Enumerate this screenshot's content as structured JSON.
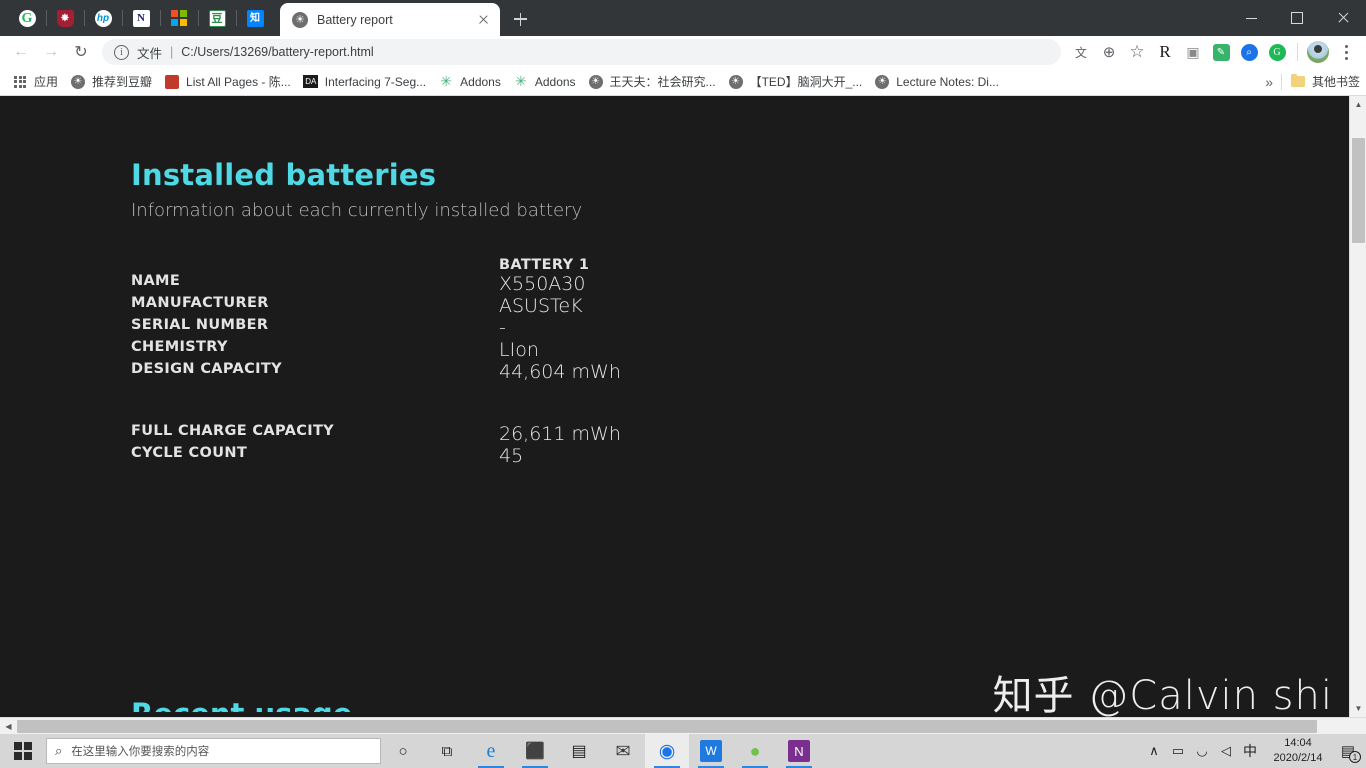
{
  "window": {
    "minimize_label": "Minimize",
    "restore_label": "Restore",
    "close_label": "Close"
  },
  "tabstrip": {
    "pinned_tabs": [
      {
        "name": "grammarly-pinned-tab",
        "glyph": "G"
      },
      {
        "name": "shield-pinned-tab",
        "glyph": "✸"
      },
      {
        "name": "hp-pinned-tab",
        "glyph": "hp"
      },
      {
        "name": "notion-pinned-tab",
        "glyph": "✉"
      },
      {
        "name": "microsoft-pinned-tab",
        "glyph": ""
      },
      {
        "name": "douban-pinned-tab",
        "glyph": "豆"
      },
      {
        "name": "zhihu-pinned-tab",
        "glyph": "知"
      }
    ],
    "active_tab": {
      "title": "Battery report",
      "favicon": "globe-icon"
    },
    "new_tab_label": "+"
  },
  "toolbar": {
    "back_label": "←",
    "forward_label": "→",
    "reload_label": "↻",
    "omnibox": {
      "info_glyph": "i",
      "scheme_label": "文件",
      "separator": "|",
      "url": "C:/Users/13269/battery-report.html"
    },
    "right_icons": [
      {
        "name": "translate-icon",
        "glyph": "文",
        "color": "#5f6368"
      },
      {
        "name": "zoom-icon",
        "glyph": "⊕",
        "color": "#5f6368"
      },
      {
        "name": "bookmark-star-icon",
        "glyph": "☆",
        "color": "#5f6368"
      },
      {
        "name": "researchgate-extension-icon",
        "glyph": "R",
        "color": "#1b1b1b"
      },
      {
        "name": "screenshot-camera-extension-icon",
        "glyph": "▣",
        "color": "#8a8a8a"
      },
      {
        "name": "evernote-extension-icon",
        "glyph": "✎",
        "color": "#2dbe60"
      },
      {
        "name": "search-extension-icon",
        "glyph": "⌕",
        "color": "#ffffff"
      },
      {
        "name": "grammarly-extension-icon",
        "glyph": "G",
        "color": "#ffffff"
      }
    ],
    "profile_label": "Profile",
    "menu_label": "Customize and control Google Chrome"
  },
  "bookmarks": {
    "items": [
      {
        "icon": "apps-grid-icon",
        "label": "应用"
      },
      {
        "icon": "globe-icon",
        "label": "推荐到豆瓣"
      },
      {
        "icon": "douban-icon",
        "label": "List All Pages - 陈..."
      },
      {
        "icon": "dark-square-icon",
        "label": "Interfacing 7-Seg..."
      },
      {
        "icon": "puzzle-icon",
        "label": "Addons"
      },
      {
        "icon": "puzzle-icon",
        "label": "Addons"
      },
      {
        "icon": "globe-icon",
        "label": "王天夫：社会研究..."
      },
      {
        "icon": "globe-icon",
        "label": "【TED】脑洞大开_..."
      },
      {
        "icon": "globe-icon",
        "label": "Lecture Notes: Di..."
      }
    ],
    "overflow_label": "»",
    "other_bookmarks_label": "其他书签"
  },
  "page": {
    "heading": "Installed batteries",
    "subheading": "Information about each currently installed battery",
    "column_header": "BATTERY 1",
    "rows": [
      {
        "label": "NAME",
        "value": "X550A30"
      },
      {
        "label": "MANUFACTURER",
        "value": "ASUSTeK"
      },
      {
        "label": "SERIAL NUMBER",
        "value": "-"
      },
      {
        "label": "CHEMISTRY",
        "value": "LIon"
      },
      {
        "label": "DESIGN CAPACITY",
        "value": "44,604 mWh"
      },
      {
        "label": "FULL CHARGE CAPACITY",
        "value": "26,611 mWh"
      },
      {
        "label": "CYCLE COUNT",
        "value": "45"
      }
    ],
    "next_heading_partial": "Recent usage",
    "watermark": "知乎 @Calvin shi",
    "accent_color": "#4fd9e4",
    "background_color": "#1b1b1b"
  },
  "scrollbars": {
    "vertical_up": "▲",
    "vertical_down": "▼",
    "horizontal_left": "◀",
    "horizontal_right": "▶"
  },
  "taskbar": {
    "start_label": "Start",
    "search_placeholder": "在这里输入你要搜索的内容",
    "search_icon_glyph": "⌕",
    "cortana_label": "○",
    "items": [
      {
        "name": "taskview-button",
        "glyph": "⧉",
        "color": "#1f1f1f",
        "bg": "transparent",
        "state": "idle"
      },
      {
        "name": "edge-taskbar-icon",
        "glyph": "e",
        "color": "#1b7fd4",
        "bg": "transparent",
        "state": "running"
      },
      {
        "name": "file-explorer-taskbar-icon",
        "glyph": "⬛",
        "color": "#f2c14e",
        "bg": "transparent",
        "state": "running"
      },
      {
        "name": "microsoft-store-taskbar-icon",
        "glyph": "▤",
        "color": "#1f1f1f",
        "bg": "transparent",
        "state": "idle"
      },
      {
        "name": "mail-taskbar-icon",
        "glyph": "✉",
        "color": "#3c3c3c",
        "bg": "transparent",
        "state": "idle"
      },
      {
        "name": "chrome-taskbar-icon",
        "glyph": "◉",
        "color": "#1a73e8",
        "bg": "transparent",
        "state": "active"
      },
      {
        "name": "wps-taskbar-icon",
        "glyph": "W",
        "color": "#ffffff",
        "bg": "#1f7ae0",
        "state": "running"
      },
      {
        "name": "wechat-taskbar-icon",
        "glyph": "●",
        "color": "#6fc24a",
        "bg": "transparent",
        "state": "running"
      },
      {
        "name": "onenote-taskbar-icon",
        "glyph": "N",
        "color": "#ffffff",
        "bg": "#7a2f8f",
        "state": "running"
      }
    ],
    "tray": [
      {
        "name": "show-hidden-icons-chevron",
        "glyph": "∧"
      },
      {
        "name": "battery-charging-icon",
        "glyph": "▭"
      },
      {
        "name": "wifi-icon",
        "glyph": "◡"
      },
      {
        "name": "volume-icon",
        "glyph": "◁"
      },
      {
        "name": "ime-mode-icon",
        "glyph": "中"
      }
    ],
    "clock": {
      "time": "14:04",
      "date": "2020/2/14"
    },
    "notification": {
      "glyph": "▤",
      "badge": "1"
    }
  }
}
